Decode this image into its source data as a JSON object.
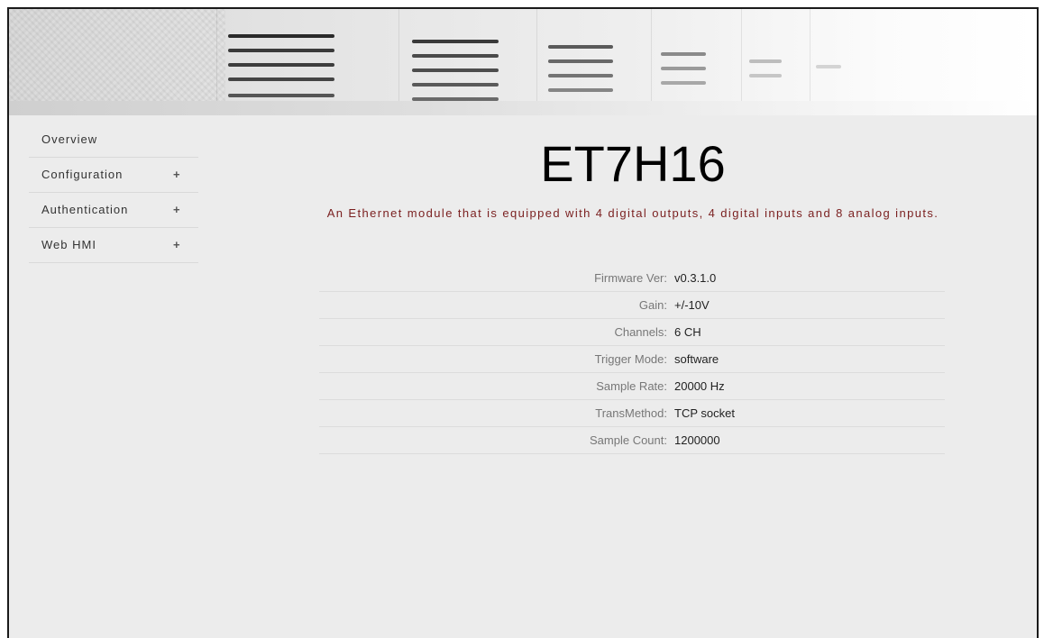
{
  "nav": {
    "items": [
      {
        "label": "Overview",
        "expandable": false
      },
      {
        "label": "Configuration",
        "expandable": true,
        "expand_glyph": "+"
      },
      {
        "label": "Authentication",
        "expandable": true,
        "expand_glyph": "+"
      },
      {
        "label": "Web HMI",
        "expandable": true,
        "expand_glyph": "+"
      }
    ]
  },
  "device": {
    "model": "ET7H16",
    "description": "An Ethernet module that is equipped with 4 digital outputs, 4 digital inputs and 8 analog inputs."
  },
  "info": {
    "rows": [
      {
        "key": "Firmware Ver:",
        "value": "v0.3.1.0"
      },
      {
        "key": "Gain:",
        "value": "+/-10V"
      },
      {
        "key": "Channels:",
        "value": "6 CH"
      },
      {
        "key": "Trigger Mode:",
        "value": "software"
      },
      {
        "key": "Sample Rate:",
        "value": "20000 Hz"
      },
      {
        "key": "TransMethod:",
        "value": "TCP socket"
      },
      {
        "key": "Sample Count:",
        "value": "1200000"
      }
    ]
  },
  "colors": {
    "background": "#ececec",
    "description_text": "#7a1f1f",
    "label_text": "#777777",
    "value_text": "#222222"
  }
}
